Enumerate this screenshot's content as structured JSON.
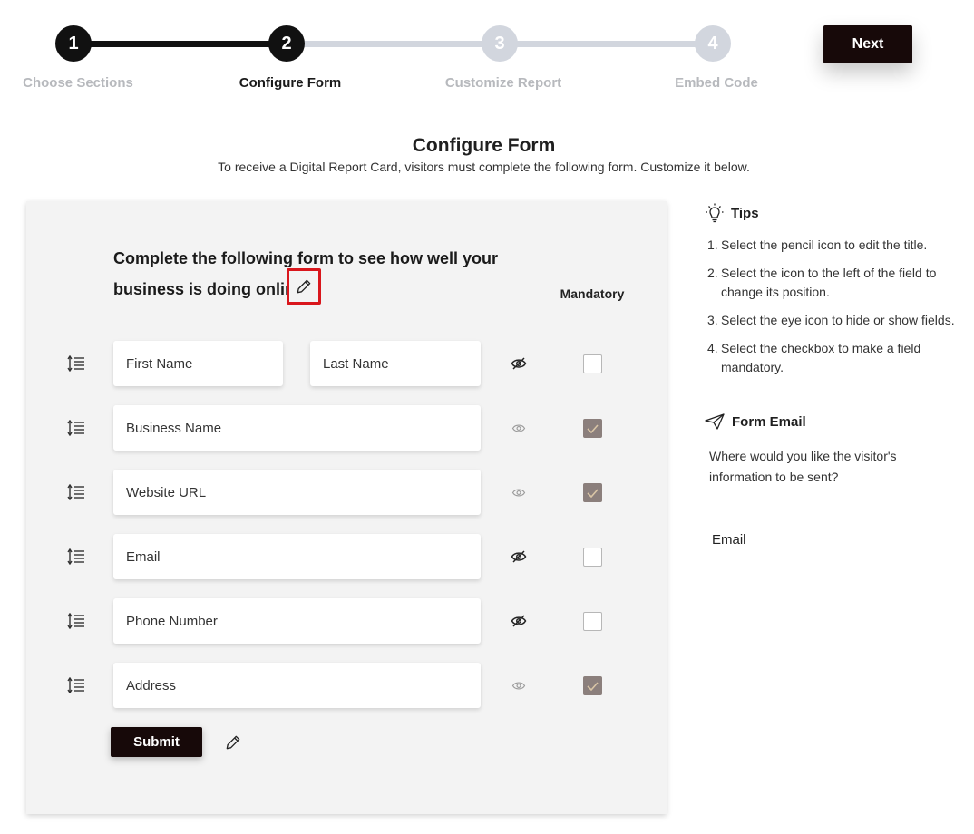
{
  "stepper": {
    "steps": [
      {
        "number": "1",
        "label": "Choose Sections",
        "state": "done"
      },
      {
        "number": "2",
        "label": "Configure Form",
        "state": "active"
      },
      {
        "number": "3",
        "label": "Customize Report",
        "state": "todo"
      },
      {
        "number": "4",
        "label": "Embed Code",
        "state": "todo"
      }
    ],
    "next_label": "Next"
  },
  "page": {
    "title": "Configure Form",
    "subtitle": "To receive a Digital Report Card, visitors must complete the following form. Customize it below."
  },
  "form": {
    "heading": "Complete the following form to see how well your business is doing online",
    "mandatory_label": "Mandatory",
    "rows": [
      {
        "fields": [
          "First Name",
          "Last Name"
        ],
        "visible": false,
        "mandatory": false
      },
      {
        "fields": [
          "Business Name"
        ],
        "visible": true,
        "mandatory": true
      },
      {
        "fields": [
          "Website URL"
        ],
        "visible": true,
        "mandatory": true
      },
      {
        "fields": [
          "Email"
        ],
        "visible": false,
        "mandatory": false
      },
      {
        "fields": [
          "Phone Number"
        ],
        "visible": false,
        "mandatory": false
      },
      {
        "fields": [
          "Address"
        ],
        "visible": true,
        "mandatory": true
      }
    ],
    "submit_label": "Submit"
  },
  "tips": {
    "heading": "Tips",
    "items": [
      "Select the pencil icon to edit the title.",
      "Select the icon to the left of the field to change its position.",
      "Select the eye icon to hide or show fields.",
      "Select the checkbox to make a field mandatory."
    ]
  },
  "form_email": {
    "heading": "Form Email",
    "question": "Where would you like the visitor's information to be sent?",
    "input_placeholder": "Email"
  },
  "icons": {
    "title_edit": "pencil-icon",
    "drag": "reorder-icon",
    "visible": "eye-icon",
    "hidden": "eye-slash-icon",
    "tips": "lightbulb-icon",
    "form_email": "paper-plane-icon"
  },
  "colors": {
    "primary_button": "#170909",
    "step_done": "#111111",
    "step_todo": "#d2d6de",
    "checkbox_checked": "#8b7f7c",
    "highlight_border": "#d9161c"
  }
}
